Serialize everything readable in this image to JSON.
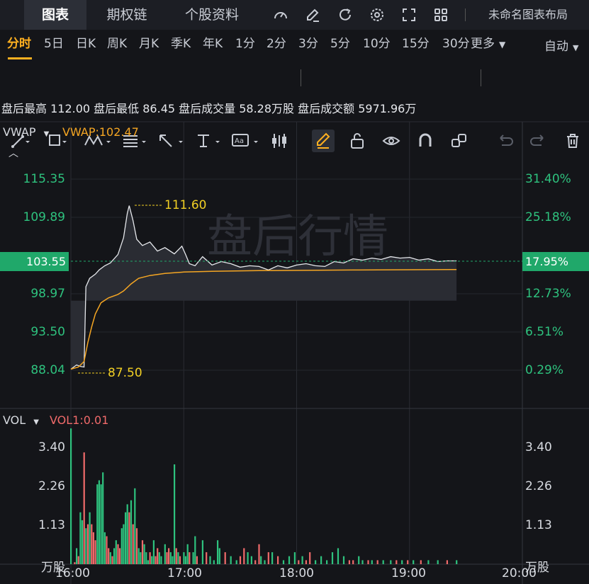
{
  "tabs": [
    {
      "label": "图表"
    },
    {
      "label": "期权链"
    },
    {
      "label": "个股资料"
    }
  ],
  "toolbar_icons": [
    "speed-icon",
    "edit-icon",
    "refresh-icon",
    "settings-icon",
    "fullscreen-icon",
    "grid-icon"
  ],
  "layout_label": "未命名图表布局",
  "periods": [
    "分时",
    "5日",
    "日K",
    "周K",
    "月K",
    "季K",
    "年K",
    "1分",
    "2分",
    "3分",
    "5分",
    "10分",
    "15分",
    "30分"
  ],
  "more_label": "更多",
  "auto_label": "自动",
  "stats": "盘后最高 112.00  盘后最低 86.45  盘后成交量 58.28万股  盘后成交额 5971.96万",
  "indicator": {
    "name": "VWAP",
    "value": "VWAP:102.47"
  },
  "vol_indicator": {
    "name": "VOL",
    "value": "VOL1:0.01"
  },
  "watermark": "盘后行情",
  "current_price": "103.55",
  "current_pct": "17.95%",
  "high_label": "111.60",
  "low_label": "87.50",
  "unit_label": "万股",
  "colors": {
    "up": "#2ec27e",
    "down": "#f06a6a",
    "vwap": "#f5a623",
    "accent": "#ffb020"
  },
  "chart_data": [
    {
      "type": "line",
      "series": [
        {
          "name": "",
          "values": []
        },
        {
          "name": "VWAP",
          "values": []
        }
      ],
      "x": [
        "16:00",
        "17:00",
        "18:00",
        "19:00",
        "20:00"
      ],
      "y_ticks": [
        "115.35",
        "109.89",
        "103.55",
        "98.97",
        "93.50",
        "88.04"
      ],
      "y2_ticks": [
        "31.40%",
        "25.18%",
        "17.95%",
        "12.73%",
        "6.51%",
        "0.29%"
      ],
      "price": [
        [
          0,
          88.2
        ],
        [
          3,
          88.8
        ],
        [
          5,
          88.6
        ],
        [
          7,
          88.5
        ],
        [
          8,
          100
        ],
        [
          10,
          101.2
        ],
        [
          13,
          101.8
        ],
        [
          15,
          102.4
        ],
        [
          18,
          103.0
        ],
        [
          21,
          103.4
        ],
        [
          25,
          104.6
        ],
        [
          28,
          107
        ],
        [
          30,
          110.5
        ],
        [
          31,
          111.6
        ],
        [
          33,
          109.5
        ],
        [
          35,
          106.8
        ],
        [
          38,
          105.9
        ],
        [
          42,
          106.4
        ],
        [
          46,
          105.1
        ],
        [
          50,
          105.6
        ],
        [
          55,
          104.7
        ],
        [
          59,
          105.8
        ],
        [
          61,
          104.6
        ],
        [
          63,
          103.3
        ],
        [
          66,
          103.0
        ],
        [
          70,
          104.3
        ],
        [
          75,
          103.1
        ],
        [
          80,
          103.6
        ],
        [
          85,
          103.3
        ],
        [
          90,
          102.8
        ],
        [
          95,
          103.0
        ],
        [
          100,
          102.9
        ],
        [
          105,
          102.4
        ],
        [
          110,
          103.0
        ],
        [
          115,
          102.7
        ],
        [
          120,
          103.1
        ],
        [
          125,
          103.3
        ],
        [
          130,
          103.0
        ],
        [
          135,
          102.9
        ],
        [
          140,
          103.6
        ],
        [
          145,
          103.4
        ],
        [
          150,
          104.0
        ],
        [
          155,
          103.8
        ],
        [
          160,
          104.1
        ],
        [
          165,
          103.9
        ],
        [
          170,
          104.3
        ],
        [
          175,
          104.1
        ],
        [
          180,
          104.2
        ],
        [
          185,
          103.8
        ],
        [
          190,
          104.0
        ],
        [
          195,
          103.6
        ],
        [
          200,
          103.7
        ],
        [
          205,
          103.7
        ]
      ],
      "vwap": [
        [
          0,
          88.2
        ],
        [
          4,
          88.5
        ],
        [
          7,
          89.3
        ],
        [
          9,
          92
        ],
        [
          11,
          94.2
        ],
        [
          13,
          96.1
        ],
        [
          16,
          97.7
        ],
        [
          20,
          98.4
        ],
        [
          25,
          98.9
        ],
        [
          28,
          99.4
        ],
        [
          32,
          100.4
        ],
        [
          36,
          101.2
        ],
        [
          42,
          101.6
        ],
        [
          50,
          101.9
        ],
        [
          60,
          102.1
        ],
        [
          75,
          102.2
        ],
        [
          100,
          102.3
        ],
        [
          150,
          102.4
        ],
        [
          205,
          102.47
        ]
      ],
      "price_range": [
        85.0,
        118.0
      ],
      "minutes_range": [
        0,
        240
      ]
    },
    {
      "type": "bar",
      "y_ticks": [
        "3.40",
        "2.26",
        "1.13"
      ],
      "x": [
        "16:00",
        "17:00",
        "18:00",
        "19:00",
        "20:00"
      ],
      "volumes": [
        [
          0,
          3.4,
          "g"
        ],
        [
          2,
          0.05,
          "r"
        ],
        [
          3,
          0.4,
          "g"
        ],
        [
          4,
          0.2,
          "r"
        ],
        [
          5,
          1.3,
          "g"
        ],
        [
          6,
          1.1,
          "g"
        ],
        [
          7,
          2.8,
          "r"
        ],
        [
          8,
          0.9,
          "g"
        ],
        [
          9,
          1.0,
          "r"
        ],
        [
          10,
          1.3,
          "g"
        ],
        [
          11,
          1.0,
          "r"
        ],
        [
          12,
          0.8,
          "r"
        ],
        [
          13,
          0.6,
          "r"
        ],
        [
          14,
          2.0,
          "g"
        ],
        [
          15,
          2.1,
          "g"
        ],
        [
          16,
          2.0,
          "g"
        ],
        [
          17,
          2.3,
          "g"
        ],
        [
          18,
          0.8,
          "g"
        ],
        [
          19,
          0.7,
          "r"
        ],
        [
          20,
          0.4,
          "r"
        ],
        [
          21,
          0.3,
          "g"
        ],
        [
          22,
          0.2,
          "r"
        ],
        [
          23,
          0.4,
          "g"
        ],
        [
          24,
          0.6,
          "g"
        ],
        [
          25,
          0.5,
          "r"
        ],
        [
          26,
          0.4,
          "r"
        ],
        [
          27,
          0.9,
          "g"
        ],
        [
          28,
          1.0,
          "g"
        ],
        [
          29,
          1.3,
          "g"
        ],
        [
          30,
          1.5,
          "g"
        ],
        [
          31,
          1.3,
          "r"
        ],
        [
          32,
          1.6,
          "g"
        ],
        [
          33,
          1.0,
          "r"
        ],
        [
          34,
          1.9,
          "g"
        ],
        [
          35,
          0.9,
          "r"
        ],
        [
          36,
          0.4,
          "g"
        ],
        [
          37,
          0.3,
          "g"
        ],
        [
          38,
          0.6,
          "r"
        ],
        [
          39,
          0.5,
          "g"
        ],
        [
          40,
          0.3,
          "g"
        ],
        [
          41,
          0.1,
          "g"
        ],
        [
          42,
          0.3,
          "r"
        ],
        [
          43,
          0.2,
          "g"
        ],
        [
          44,
          0.6,
          "g"
        ],
        [
          45,
          0.2,
          "r"
        ],
        [
          46,
          0.4,
          "r"
        ],
        [
          47,
          0.3,
          "g"
        ],
        [
          48,
          0.2,
          "g"
        ],
        [
          50,
          0.5,
          "g"
        ],
        [
          51,
          0.3,
          "r"
        ],
        [
          52,
          0.4,
          "r"
        ],
        [
          53,
          0.3,
          "g"
        ],
        [
          54,
          0.2,
          "g"
        ],
        [
          55,
          2.5,
          "g"
        ],
        [
          56,
          0.4,
          "r"
        ],
        [
          57,
          0.3,
          "g"
        ],
        [
          58,
          0.2,
          "r"
        ],
        [
          60,
          0.3,
          "g"
        ],
        [
          61,
          0.2,
          "g"
        ],
        [
          62,
          0.5,
          "g"
        ],
        [
          63,
          0.3,
          "r"
        ],
        [
          65,
          0.3,
          "g"
        ],
        [
          66,
          0.7,
          "g"
        ],
        [
          67,
          0.2,
          "r"
        ],
        [
          70,
          0.6,
          "g"
        ],
        [
          72,
          0.3,
          "r"
        ],
        [
          74,
          0.2,
          "g"
        ],
        [
          76,
          0.1,
          "g"
        ],
        [
          78,
          0.6,
          "g"
        ],
        [
          79,
          0.4,
          "g"
        ],
        [
          82,
          0.3,
          "r"
        ],
        [
          85,
          0.2,
          "g"
        ],
        [
          88,
          0.1,
          "g"
        ],
        [
          90,
          0.2,
          "r"
        ],
        [
          92,
          0.4,
          "r"
        ],
        [
          94,
          0.3,
          "g"
        ],
        [
          96,
          0.2,
          "g"
        ],
        [
          98,
          0.1,
          "r"
        ],
        [
          100,
          0.5,
          "r"
        ],
        [
          101,
          0.2,
          "g"
        ],
        [
          103,
          0.1,
          "g"
        ],
        [
          105,
          0.3,
          "r"
        ],
        [
          107,
          0.3,
          "g"
        ],
        [
          110,
          0.2,
          "r"
        ],
        [
          113,
          0.1,
          "g"
        ],
        [
          116,
          0.2,
          "g"
        ],
        [
          119,
          0.3,
          "g"
        ],
        [
          121,
          0.1,
          "r"
        ],
        [
          123,
          0.2,
          "g"
        ],
        [
          125,
          0.1,
          "r"
        ],
        [
          127,
          0.3,
          "r"
        ],
        [
          130,
          0.1,
          "g"
        ],
        [
          133,
          0.2,
          "g"
        ],
        [
          136,
          0.1,
          "g"
        ],
        [
          139,
          0.3,
          "g"
        ],
        [
          142,
          0.4,
          "g"
        ],
        [
          145,
          0.2,
          "g"
        ],
        [
          148,
          0.1,
          "r"
        ],
        [
          150,
          0.1,
          "r"
        ],
        [
          153,
          0.2,
          "g"
        ],
        [
          155,
          0.1,
          "g"
        ],
        [
          158,
          0.1,
          "r"
        ],
        [
          160,
          0.1,
          "g"
        ],
        [
          163,
          0.1,
          "r"
        ],
        [
          166,
          0.1,
          "g"
        ],
        [
          170,
          0.1,
          "g"
        ],
        [
          173,
          0.1,
          "r"
        ],
        [
          176,
          0.1,
          "g"
        ],
        [
          179,
          0.1,
          "r"
        ],
        [
          182,
          0.1,
          "g"
        ],
        [
          186,
          0.1,
          "r"
        ],
        [
          190,
          0.1,
          "g"
        ],
        [
          195,
          0.1,
          "g"
        ],
        [
          200,
          0.1,
          "r"
        ],
        [
          205,
          0.1,
          "g"
        ]
      ],
      "vol_range": [
        0,
        3.9
      ],
      "minutes_range": [
        0,
        240
      ]
    }
  ]
}
